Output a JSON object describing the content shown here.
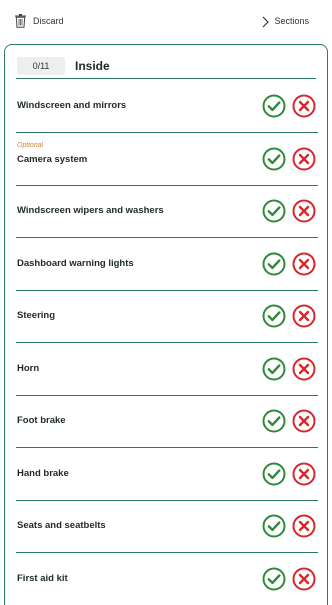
{
  "toolbar": {
    "discard_label": "Discard",
    "sections_label": "Sections"
  },
  "section": {
    "counter": "0/11",
    "title": "Inside"
  },
  "colors": {
    "accent": "#2c7b5e",
    "pass": "#2f8a3a",
    "fail": "#d8262b",
    "optional": "#c7873a"
  },
  "items": [
    {
      "label": "Windscreen and mirrors",
      "optional": ""
    },
    {
      "label": "Camera system",
      "optional": "Optional"
    },
    {
      "label": "Windscreen wipers and washers",
      "optional": ""
    },
    {
      "label": "Dashboard warning lights",
      "optional": ""
    },
    {
      "label": "Steering",
      "optional": ""
    },
    {
      "label": "Horn",
      "optional": ""
    },
    {
      "label": "Foot brake",
      "optional": ""
    },
    {
      "label": "Hand brake",
      "optional": ""
    },
    {
      "label": "Seats and seatbelts",
      "optional": ""
    },
    {
      "label": "First aid kit",
      "optional": ""
    }
  ]
}
